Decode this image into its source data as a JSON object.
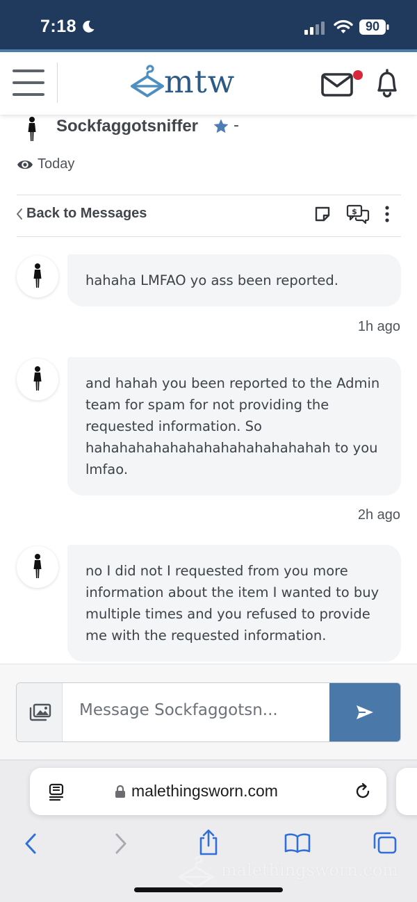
{
  "status": {
    "time": "7:18",
    "battery": "90"
  },
  "header": {
    "logo_text": "mtw"
  },
  "thread": {
    "sender_name": "Sockfaggotsniffer",
    "name_suffix": "-",
    "last_seen": "Today",
    "back_label": "Back to Messages"
  },
  "messages": [
    {
      "text": "hahaha LMFAO yo ass been reported.",
      "time": "1h ago"
    },
    {
      "text": "and hahah you been reported to the Admin team for spam for not providing the requested information. So hahahahahahahahahahahahahahah to you lmfao.",
      "time": "2h ago"
    },
    {
      "text": "no I did not I requested from you more information about the item I wanted to buy multiple times and you refused to provide me with the requested information.",
      "time": ""
    }
  ],
  "composer": {
    "placeholder": "Message Sockfaggotsn..."
  },
  "browser": {
    "url": "malethingsworn.com",
    "watermark": "malethingsworn.com"
  },
  "colors": {
    "status_bar": "#1f3a5c",
    "brand": "#2b5a86",
    "send_button": "#4a78a8",
    "notification_dot": "#d9263b",
    "bubble": "#f4f5f7"
  },
  "icons": [
    "moon-icon",
    "signal-icon",
    "wifi-icon",
    "battery-icon",
    "hamburger-menu-icon",
    "mail-icon",
    "bell-icon",
    "female-figure-icon",
    "star-icon",
    "eye-icon",
    "chevron-left-icon",
    "note-icon",
    "price-offer-icon",
    "more-vertical-icon",
    "photo-attach-icon",
    "send-icon",
    "reader-icon",
    "lock-icon",
    "reload-icon",
    "share-icon",
    "bookmarks-icon",
    "tabs-icon"
  ]
}
